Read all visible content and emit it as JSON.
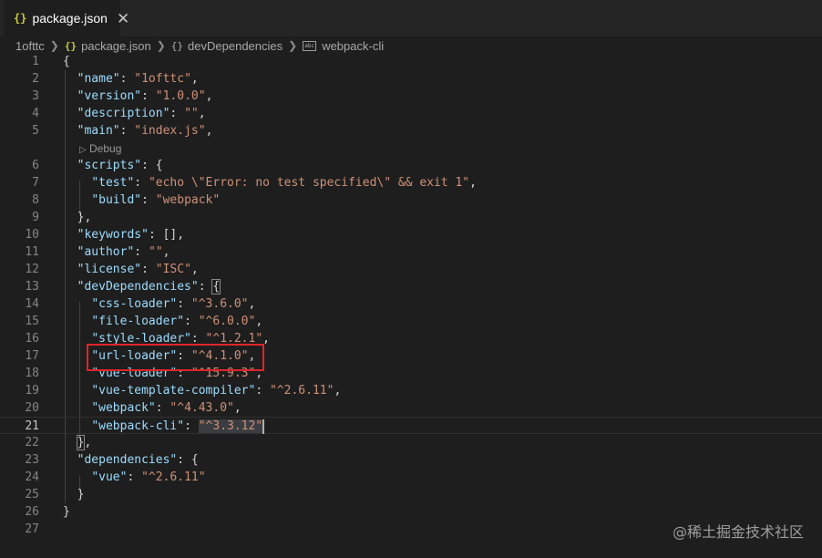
{
  "tab": {
    "icon": "{}",
    "label": "package.json",
    "close": "✕"
  },
  "breadcrumb": [
    "1ofttc",
    "package.json",
    "devDependencies",
    "webpack-cli"
  ],
  "breadcrumb_icons": {
    "json": "{}",
    "braces": "{}",
    "string_badge": "abc"
  },
  "codelens": {
    "label": "Debug"
  },
  "lines": [
    {
      "n": "1",
      "seg": [
        [
          "p",
          "{"
        ]
      ]
    },
    {
      "n": "2",
      "seg": [
        [
          "p",
          "  "
        ],
        [
          "k",
          "\"name\""
        ],
        [
          "p",
          ": "
        ],
        [
          "s",
          "\"1ofttc\""
        ],
        [
          "p",
          ","
        ]
      ]
    },
    {
      "n": "3",
      "seg": [
        [
          "p",
          "  "
        ],
        [
          "k",
          "\"version\""
        ],
        [
          "p",
          ": "
        ],
        [
          "s",
          "\"1.0.0\""
        ],
        [
          "p",
          ","
        ]
      ]
    },
    {
      "n": "4",
      "seg": [
        [
          "p",
          "  "
        ],
        [
          "k",
          "\"description\""
        ],
        [
          "p",
          ": "
        ],
        [
          "s",
          "\"\""
        ],
        [
          "p",
          ","
        ]
      ]
    },
    {
      "n": "5",
      "seg": [
        [
          "p",
          "  "
        ],
        [
          "k",
          "\"main\""
        ],
        [
          "p",
          ": "
        ],
        [
          "s",
          "\"index.js\""
        ],
        [
          "p",
          ","
        ]
      ]
    },
    {
      "n": "6",
      "seg": [
        [
          "p",
          "  "
        ],
        [
          "k",
          "\"scripts\""
        ],
        [
          "p",
          ": {"
        ]
      ]
    },
    {
      "n": "7",
      "seg": [
        [
          "p",
          "    "
        ],
        [
          "k",
          "\"test\""
        ],
        [
          "p",
          ": "
        ],
        [
          "s",
          "\"echo \\\"Error: no test specified\\\" && exit 1\""
        ],
        [
          "p",
          ","
        ]
      ]
    },
    {
      "n": "8",
      "seg": [
        [
          "p",
          "    "
        ],
        [
          "k",
          "\"build\""
        ],
        [
          "p",
          ": "
        ],
        [
          "s",
          "\"webpack\""
        ]
      ]
    },
    {
      "n": "9",
      "seg": [
        [
          "p",
          "  },"
        ]
      ]
    },
    {
      "n": "10",
      "seg": [
        [
          "p",
          "  "
        ],
        [
          "k",
          "\"keywords\""
        ],
        [
          "p",
          ": [],"
        ]
      ]
    },
    {
      "n": "11",
      "seg": [
        [
          "p",
          "  "
        ],
        [
          "k",
          "\"author\""
        ],
        [
          "p",
          ": "
        ],
        [
          "s",
          "\"\""
        ],
        [
          "p",
          ","
        ]
      ]
    },
    {
      "n": "12",
      "seg": [
        [
          "p",
          "  "
        ],
        [
          "k",
          "\"license\""
        ],
        [
          "p",
          ": "
        ],
        [
          "s",
          "\"ISC\""
        ],
        [
          "p",
          ","
        ]
      ]
    },
    {
      "n": "13",
      "seg": [
        [
          "p",
          "  "
        ],
        [
          "k",
          "\"devDependencies\""
        ],
        [
          "p",
          ": "
        ],
        [
          "bm",
          "{"
        ]
      ]
    },
    {
      "n": "14",
      "seg": [
        [
          "p",
          "    "
        ],
        [
          "k",
          "\"css-loader\""
        ],
        [
          "p",
          ": "
        ],
        [
          "s",
          "\"^3.6.0\""
        ],
        [
          "p",
          ","
        ]
      ]
    },
    {
      "n": "15",
      "seg": [
        [
          "p",
          "    "
        ],
        [
          "k",
          "\"file-loader\""
        ],
        [
          "p",
          ": "
        ],
        [
          "s",
          "\"^6.0.0\""
        ],
        [
          "p",
          ","
        ]
      ]
    },
    {
      "n": "16",
      "seg": [
        [
          "p",
          "    "
        ],
        [
          "k",
          "\"style-loader\""
        ],
        [
          "p",
          ": "
        ],
        [
          "s",
          "\"^1.2.1\""
        ],
        [
          "p",
          ","
        ]
      ]
    },
    {
      "n": "17",
      "seg": [
        [
          "p",
          "    "
        ],
        [
          "k",
          "\"url-loader\""
        ],
        [
          "p",
          ": "
        ],
        [
          "s",
          "\"^4.1.0\""
        ],
        [
          "p",
          ","
        ]
      ]
    },
    {
      "n": "18",
      "seg": [
        [
          "p",
          "    "
        ],
        [
          "k",
          "\"vue-loader\""
        ],
        [
          "p",
          ": "
        ],
        [
          "s",
          "\"^15.9.3\""
        ],
        [
          "p",
          ","
        ]
      ]
    },
    {
      "n": "19",
      "seg": [
        [
          "p",
          "    "
        ],
        [
          "k",
          "\"vue-template-compiler\""
        ],
        [
          "p",
          ": "
        ],
        [
          "s",
          "\"^2.6.11\""
        ],
        [
          "p",
          ","
        ]
      ]
    },
    {
      "n": "20",
      "seg": [
        [
          "p",
          "    "
        ],
        [
          "k",
          "\"webpack\""
        ],
        [
          "p",
          ": "
        ],
        [
          "s",
          "\"^4.43.0\""
        ],
        [
          "p",
          ","
        ]
      ]
    },
    {
      "n": "21",
      "seg": [
        [
          "p",
          "    "
        ],
        [
          "k",
          "\"webpack-cli\""
        ],
        [
          "p",
          ": "
        ],
        [
          "sel",
          "\"^3.3.12\""
        ],
        [
          "cursor",
          ""
        ]
      ]
    },
    {
      "n": "22",
      "seg": [
        [
          "p",
          "  "
        ],
        [
          "bm",
          "}"
        ],
        [
          "p",
          ","
        ]
      ]
    },
    {
      "n": "23",
      "seg": [
        [
          "p",
          "  "
        ],
        [
          "k",
          "\"dependencies\""
        ],
        [
          "p",
          ": {"
        ]
      ]
    },
    {
      "n": "24",
      "seg": [
        [
          "p",
          "    "
        ],
        [
          "k",
          "\"vue\""
        ],
        [
          "p",
          ": "
        ],
        [
          "s",
          "\"^2.6.11\""
        ]
      ]
    },
    {
      "n": "25",
      "seg": [
        [
          "p",
          "  }"
        ]
      ]
    },
    {
      "n": "26",
      "seg": [
        [
          "p",
          "}"
        ]
      ]
    },
    {
      "n": "27",
      "seg": []
    }
  ],
  "current_line": "21",
  "highlighted_line": "17",
  "colors": {
    "key": "#9cdcfe",
    "string": "#ce9178",
    "punct": "#d4d4d4",
    "highlight_box": "#e0252b"
  },
  "watermark": "@稀土掘金技术社区"
}
